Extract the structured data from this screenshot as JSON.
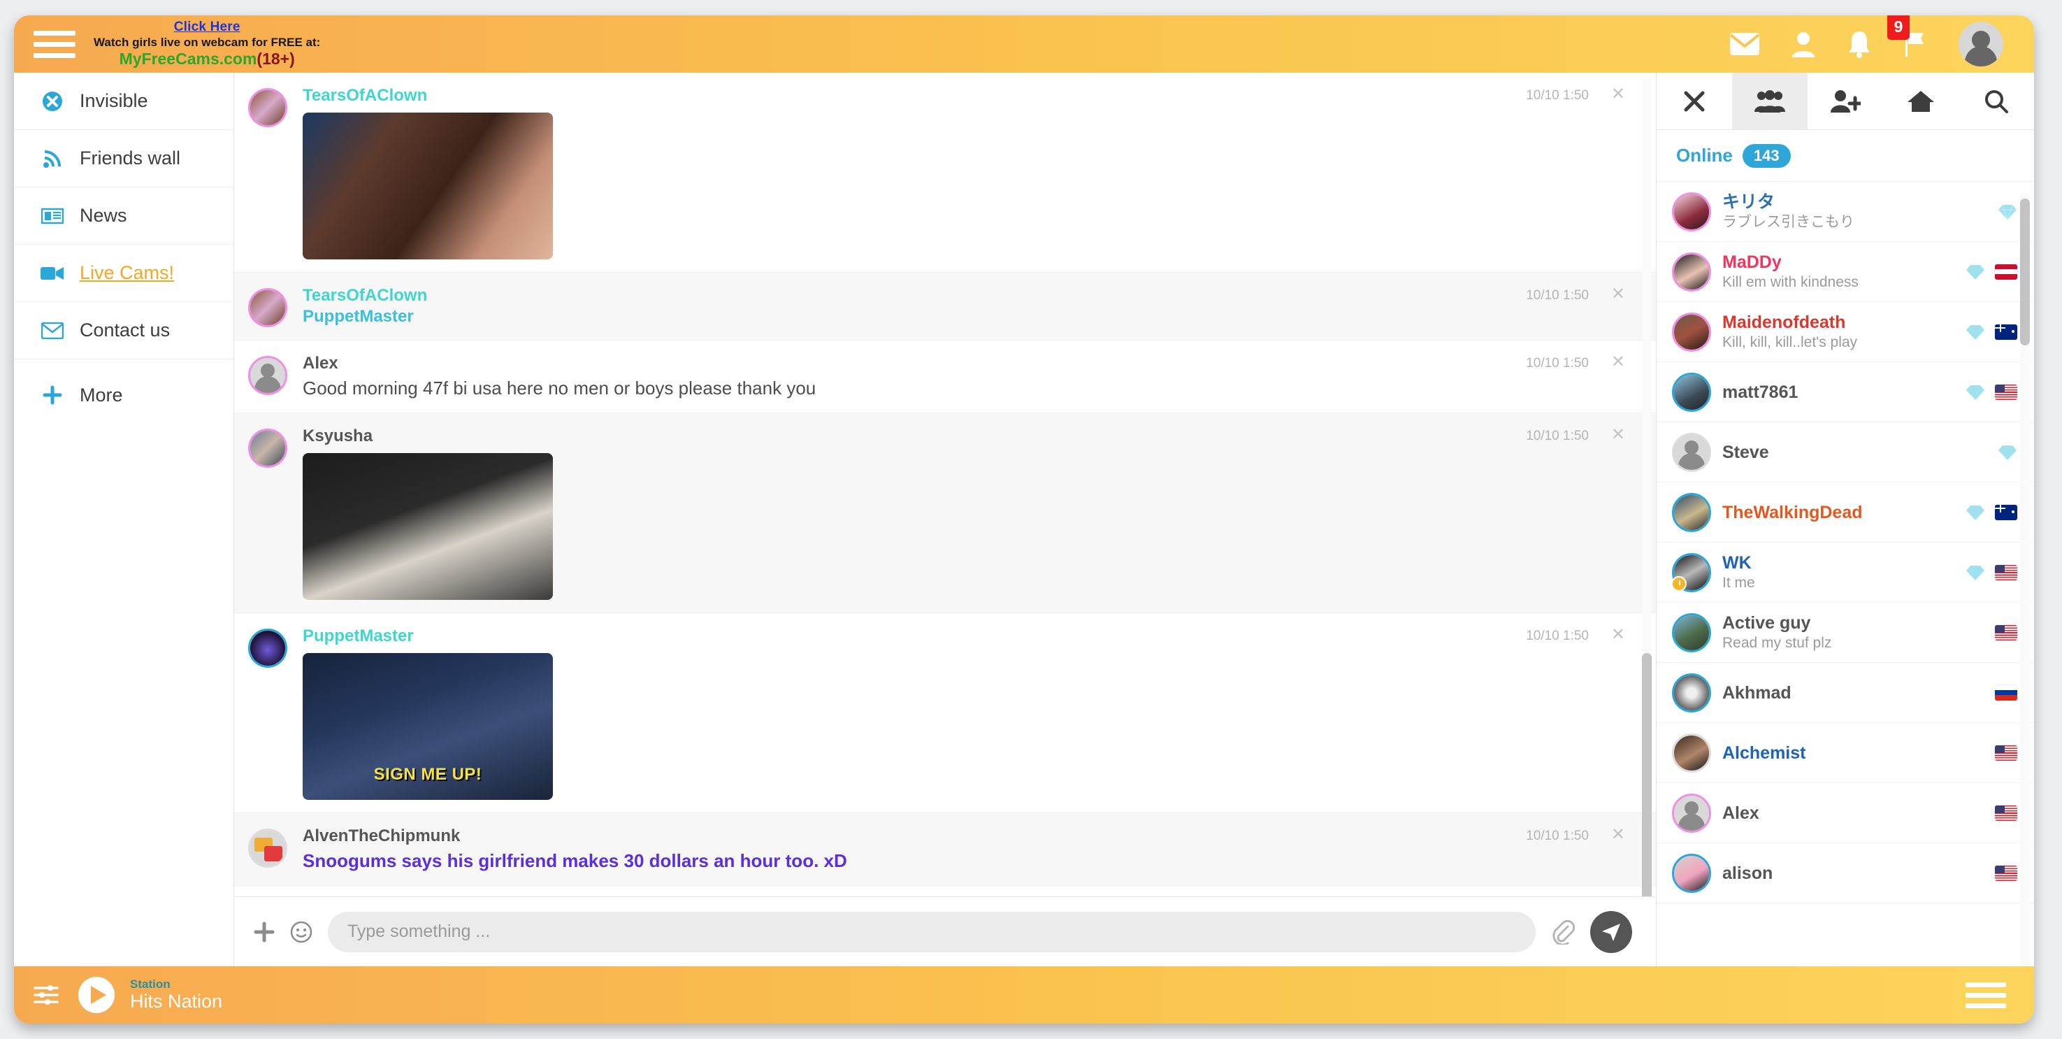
{
  "header": {
    "menu_icon": "hamburger-icon",
    "promo": {
      "click_here": "Click Here",
      "line2": "Watch girls live on webcam for FREE at:",
      "site": "MyFreeCams.com",
      "age": "(18+)"
    },
    "icons": [
      {
        "name": "mail-icon"
      },
      {
        "name": "contacts-icon"
      },
      {
        "name": "bell-icon"
      },
      {
        "name": "flag-icon",
        "badge": "9"
      }
    ],
    "avatar_name": "user-avatar"
  },
  "sidebar": {
    "items": [
      {
        "label": "Invisible",
        "icon": "invisible-status-icon"
      },
      {
        "label": "Friends wall",
        "icon": "rss-feed-icon"
      },
      {
        "label": "News",
        "icon": "newspaper-icon"
      },
      {
        "label": "Live Cams!",
        "icon": "video-camera-icon"
      },
      {
        "label": "Contact us",
        "icon": "envelope-icon"
      },
      {
        "label": "More",
        "icon": "plus-icon"
      }
    ]
  },
  "chat": {
    "messages": [
      {
        "author": "TearsOfAClown",
        "author2": "",
        "text": "",
        "time": "10/10 1:50",
        "has_image": true,
        "image_caption": "",
        "image_style": "img-a"
      },
      {
        "author": "TearsOfAClown",
        "author2": "PuppetMaster",
        "text": "",
        "time": "10/10 1:50",
        "has_image": false,
        "image_caption": "",
        "image_style": ""
      },
      {
        "author": "Alex",
        "author2": "",
        "text": "Good morning 47f bi usa here no men or boys please thank you",
        "time": "10/10 1:50",
        "has_image": false,
        "image_caption": "",
        "image_style": ""
      },
      {
        "author": "Ksyusha",
        "author2": "",
        "text": "",
        "time": "10/10 1:50",
        "has_image": true,
        "image_caption": "",
        "image_style": "img-b"
      },
      {
        "author": "PuppetMaster",
        "author2": "",
        "text": "",
        "time": "10/10 1:50",
        "has_image": true,
        "image_caption": "SIGN ME UP!",
        "image_style": "img-c"
      },
      {
        "author": "AlvenTheChipmunk",
        "author2": "",
        "text": "Snoogums says his girlfriend makes 30 dollars an hour too. xD",
        "time": "10/10 1:50",
        "has_image": false,
        "image_caption": "",
        "image_style": ""
      }
    ],
    "composer": {
      "add_icon": "plus-icon",
      "emoji_icon": "smiley-icon",
      "placeholder": "Type something ...",
      "value": "",
      "attach_icon": "paperclip-icon",
      "send_icon": "send-paper-plane-icon"
    }
  },
  "right_panel": {
    "tabs": [
      {
        "name": "close-icon",
        "active": false
      },
      {
        "name": "group-members-icon",
        "active": true
      },
      {
        "name": "add-friend-icon",
        "active": false
      },
      {
        "name": "home-icon",
        "active": false
      },
      {
        "name": "search-icon",
        "active": false
      }
    ],
    "online_label": "Online",
    "online_count": "143",
    "users": [
      {
        "name": "キリタ",
        "status": "ラブレス引きこもり",
        "name_color": "#2f6fb0",
        "ring": "pink",
        "gem": true,
        "flag": ""
      },
      {
        "name": "MaDDy",
        "status": "Kill em with kindness",
        "name_color": "#f0365f",
        "ring": "pink",
        "gem": true,
        "flag": "at"
      },
      {
        "name": "Maidenofdeath",
        "status": "Kill, kill, kill..let's play",
        "name_color": "#d63a2f",
        "ring": "pink",
        "gem": true,
        "flag": "au"
      },
      {
        "name": "matt7861",
        "status": "",
        "name_color": "#555555",
        "ring": "blue",
        "gem": true,
        "flag": "us"
      },
      {
        "name": "Steve",
        "status": "",
        "name_color": "#555555",
        "ring": "grey",
        "gem": true,
        "flag": ""
      },
      {
        "name": "TheWalkingDead",
        "status": "",
        "name_color": "#e1591f",
        "ring": "blue",
        "gem": true,
        "flag": "au"
      },
      {
        "name": "WK",
        "status": "It me",
        "name_color": "#1f63b5",
        "ring": "blue",
        "gem": true,
        "flag": "us",
        "clock": true
      },
      {
        "name": "Active guy",
        "status": "Read my stuf plz",
        "name_color": "#555555",
        "ring": "blue",
        "gem": false,
        "flag": "us"
      },
      {
        "name": "Akhmad",
        "status": "",
        "name_color": "#555555",
        "ring": "blue",
        "gem": false,
        "flag": "ru"
      },
      {
        "name": "Alchemist",
        "status": "",
        "name_color": "#1f63b5",
        "ring": "grey",
        "gem": false,
        "flag": "us"
      },
      {
        "name": "Alex",
        "status": "",
        "name_color": "#555555",
        "ring": "pink",
        "gem": false,
        "flag": "us"
      },
      {
        "name": "alison",
        "status": "",
        "name_color": "#555555",
        "ring": "blue",
        "gem": false,
        "flag": "us"
      }
    ]
  },
  "player": {
    "equalizer_icon": "equalizer-icon",
    "play_icon": "play-icon",
    "station_label": "Station",
    "station_name": "Hits Nation",
    "menu_icon": "hamburger-icon"
  },
  "colors": {
    "header_start": "#f7a950",
    "header_end": "#fcd45c",
    "accent_blue": "#29a7d8",
    "live_orange": "#f5a623"
  }
}
